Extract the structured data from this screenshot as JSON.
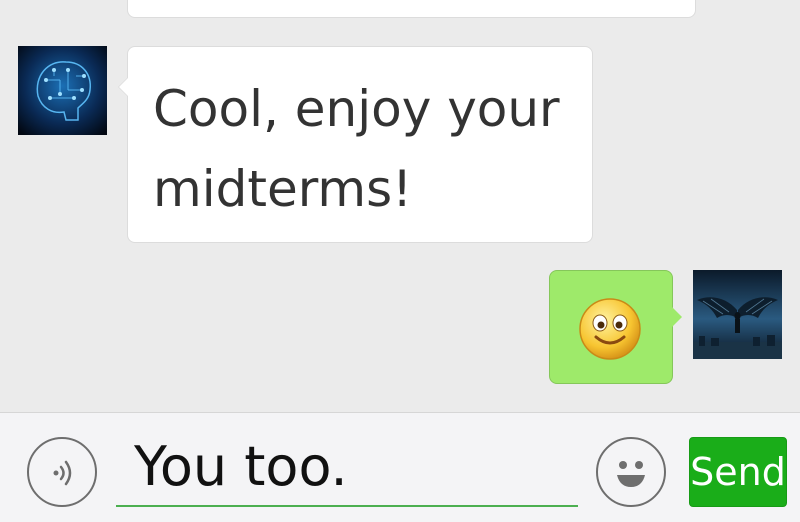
{
  "messages": [
    {
      "sender": "other",
      "avatar": "brain-circuit-avatar",
      "text": "Cool, enjoy your midterms!"
    },
    {
      "sender": "self",
      "avatar": "winged-figure-avatar",
      "content": "smiley-emoji"
    }
  ],
  "input": {
    "value": "You too.",
    "voice_icon": "voice-icon",
    "emoji_icon": "emoji-icon",
    "send_label": "Send"
  },
  "colors": {
    "background": "#ebebeb",
    "incoming_bubble": "#ffffff",
    "outgoing_bubble": "#9eea6a",
    "send_button": "#1aad19",
    "input_underline": "#4caf50"
  }
}
